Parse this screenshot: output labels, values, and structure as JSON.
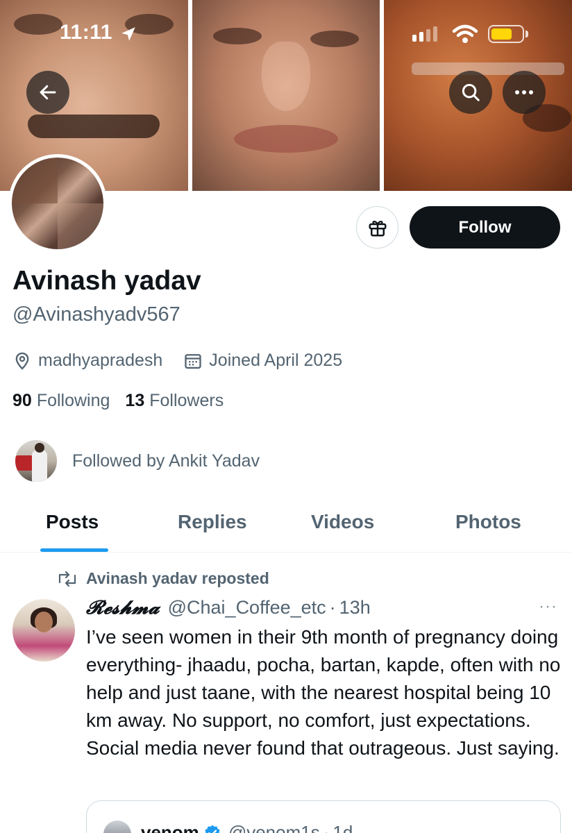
{
  "status_bar": {
    "time": "11:11"
  },
  "banner": {
    "icons": [
      "back-arrow-icon",
      "search-icon",
      "more-icon"
    ]
  },
  "actions": {
    "follow_label": "Follow",
    "gift_icon": "gift-icon"
  },
  "profile": {
    "display_name": "Avinash yadav",
    "handle": "@Avinashyadv567",
    "location": "madhyapradesh",
    "joined": "Joined April 2025",
    "following_count": "90",
    "following_label": "Following",
    "followers_count": "13",
    "followers_label": "Followers",
    "followed_by": "Followed by Ankit Yadav"
  },
  "tabs": [
    {
      "label": "Posts",
      "active": true
    },
    {
      "label": "Replies",
      "active": false
    },
    {
      "label": "Videos",
      "active": false
    },
    {
      "label": "Photos",
      "active": false
    }
  ],
  "post": {
    "repost_label": "Avinash yadav reposted",
    "author_name": "𝓡𝓮𝓼𝓱𝓶𝓪",
    "author_handle": "@Chai_Coffee_etc",
    "separator": "·",
    "time": "13h",
    "more": "···",
    "text": "I’ve seen women in their 9th month of pregnancy doing everything- jhaadu, pocha, bartan, kapde, often with no help and just taane, with the nearest hospital being 10 km away. No support, no comfort, just expectations. Social media never found that outrageous. Just saying.",
    "quote": {
      "name": "venom",
      "handle": "@venom1s",
      "separator": "·",
      "time": "1d"
    }
  },
  "colors": {
    "accent": "#1d9bf0",
    "text_primary": "#0f1419",
    "text_secondary": "#536471",
    "battery": "#ffd60a"
  }
}
